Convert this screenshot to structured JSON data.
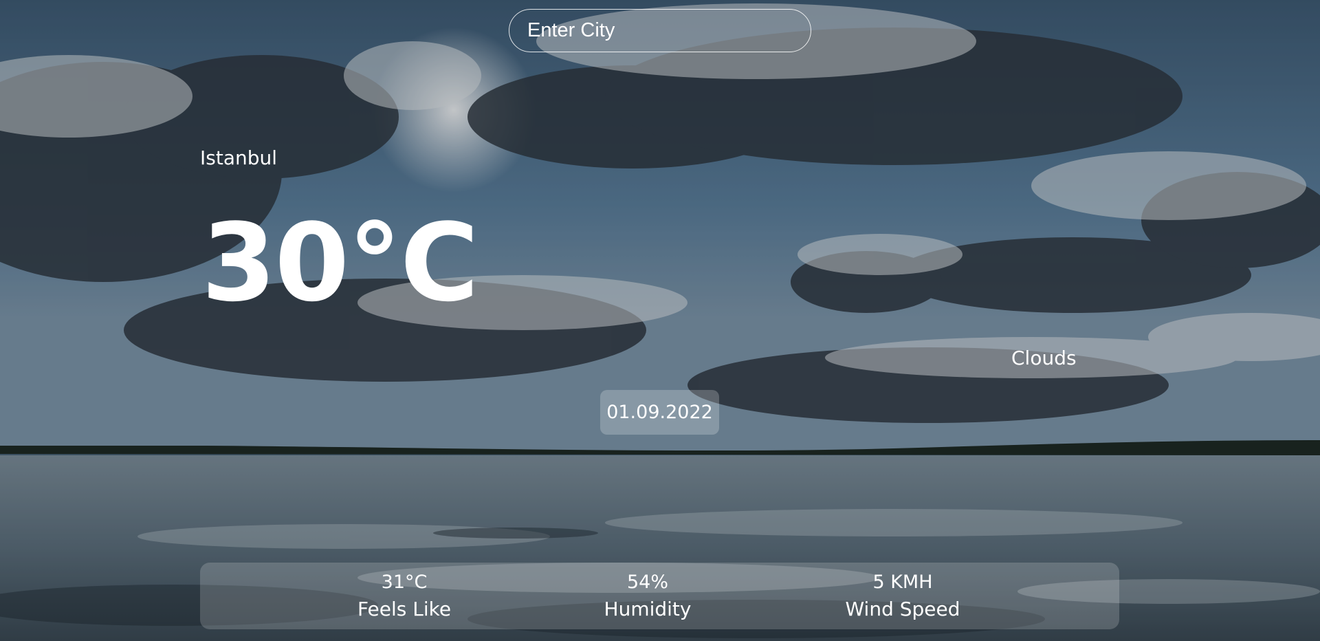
{
  "search": {
    "placeholder": "Enter City",
    "value": ""
  },
  "weather": {
    "city": "Istanbul",
    "temperature": "30°C",
    "condition": "Clouds",
    "date": "01.09.2022"
  },
  "stats": [
    {
      "value": "31°C",
      "label": "Feels Like"
    },
    {
      "value": "54%",
      "label": "Humidity"
    },
    {
      "value": "5 KMH",
      "label": "Wind Speed"
    }
  ],
  "colors": {
    "text": "#ffffff",
    "sky": "#4a6479",
    "water": "#5b6d79"
  }
}
